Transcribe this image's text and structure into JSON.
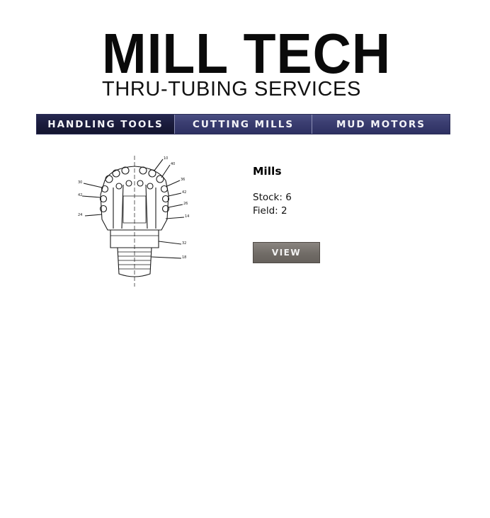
{
  "header": {
    "logo_title": "MILL TECH",
    "logo_subtitle": "THRU-TUBING SERVICES"
  },
  "nav": {
    "items": [
      {
        "label": "HANDLING TOOLS",
        "active": true
      },
      {
        "label": "CUTTING MILLS",
        "active": false
      },
      {
        "label": "MUD MOTORS",
        "active": false
      }
    ]
  },
  "product": {
    "image_icon": "mill-bit-drawing-icon",
    "title": "Mills",
    "stock": "Stock: 6",
    "field": "Field: 2",
    "view_label": "VIEW"
  },
  "colors": {
    "nav_bg": "#3a3d6e",
    "nav_active_bg": "#1a1b3c",
    "button_bg": "#716c67"
  }
}
